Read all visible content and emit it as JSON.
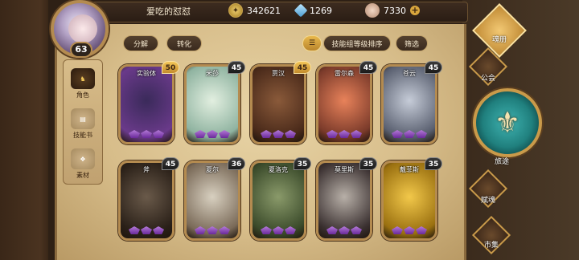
{
  "player": {
    "name": "爱吃的怼怼",
    "level": "63"
  },
  "resources": {
    "gold": "342621",
    "gems": "1269",
    "stones": "7330"
  },
  "actions": {
    "decompose": "分解",
    "convert": "转化",
    "sort": "技能组等级排序",
    "filter": "筛选"
  },
  "left_tabs": [
    {
      "label": "角色",
      "active": true
    },
    {
      "label": "技能书",
      "active": false
    },
    {
      "label": "素材",
      "active": false
    }
  ],
  "heroes": [
    {
      "name": "实验体",
      "level": "50",
      "badge": "gold",
      "colors": [
        "#3a2a5a",
        "#6a3a8a"
      ]
    },
    {
      "name": "米莎",
      "level": "45",
      "badge": "dark",
      "colors": [
        "#e2efe0",
        "#8fb3a0"
      ]
    },
    {
      "name": "贾汉",
      "level": "45",
      "badge": "gold",
      "colors": [
        "#8a5a3a",
        "#4a2a1a"
      ]
    },
    {
      "name": "雷尔森",
      "level": "45",
      "badge": "dark",
      "colors": [
        "#e8825a",
        "#7a3a2a"
      ]
    },
    {
      "name": "苍云",
      "level": "45",
      "badge": "dark",
      "colors": [
        "#c6ccd8",
        "#5a6070"
      ]
    },
    {
      "name": "斧",
      "level": "45",
      "badge": "dark",
      "colors": [
        "#6a5a4a",
        "#2a2018"
      ]
    },
    {
      "name": "夏尔",
      "level": "36",
      "badge": "dark",
      "colors": [
        "#d8d0c0",
        "#7a6a58"
      ]
    },
    {
      "name": "夏洛克",
      "level": "35",
      "badge": "dark",
      "colors": [
        "#8a9a6a",
        "#3a4a2a"
      ]
    },
    {
      "name": "莫里斯",
      "level": "35",
      "badge": "dark",
      "colors": [
        "#b8b0a8",
        "#3a3030"
      ]
    },
    {
      "name": "戴菲斯",
      "level": "35",
      "badge": "dark",
      "colors": [
        "#f2c84a",
        "#9a7010"
      ]
    }
  ],
  "right_menu": {
    "soul_book": "魂册",
    "guild": "公会",
    "journey": "旅途",
    "bond": "赋魂",
    "market": "市集"
  }
}
